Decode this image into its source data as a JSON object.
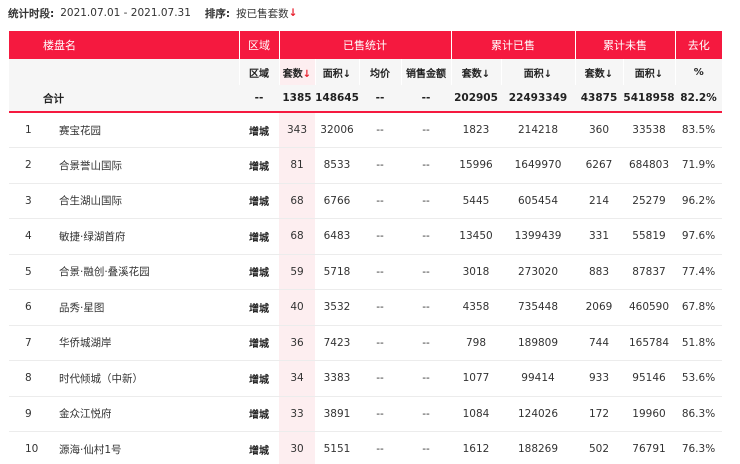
{
  "filter": {
    "period_label": "统计时段:",
    "period_value": "2021.07.01 - 2021.07.31",
    "sort_label": "排序:",
    "sort_value": "按已售套数",
    "sort_arrow": "↓"
  },
  "header": {
    "project": "楼盘名",
    "region": "区域",
    "sold_stats": "已售统计",
    "cum_sold": "累计已售",
    "cum_unsold": "累计未售",
    "absorption": "去化"
  },
  "subheader": {
    "region": "区域",
    "units": "套数",
    "units_arrow": "↓",
    "area": "面积↓",
    "avg_price": "均价",
    "sales_amount": "销售金额",
    "cum_units": "套数↓",
    "cum_area": "面积↓",
    "unsold_units": "套数↓",
    "unsold_area": "面积↓",
    "percent": "%"
  },
  "total": {
    "label": "合计",
    "region": "--",
    "units": "1385",
    "area": "148645",
    "avg_price": "--",
    "amount": "--",
    "cum_units": "202905",
    "cum_area": "22493349",
    "unsold_units": "43875",
    "unsold_area": "5418958",
    "rate": "82.2%"
  },
  "rows": [
    {
      "idx": "1",
      "name": "赛宝花园",
      "region": "增城",
      "units": "343",
      "area": "32006",
      "avg": "--",
      "amount": "--",
      "cum_units": "1823",
      "cum_area": "214218",
      "unsold_units": "360",
      "unsold_area": "33538",
      "rate": "83.5%"
    },
    {
      "idx": "2",
      "name": "合景誉山国际",
      "region": "增城",
      "units": "81",
      "area": "8533",
      "avg": "--",
      "amount": "--",
      "cum_units": "15996",
      "cum_area": "1649970",
      "unsold_units": "6267",
      "unsold_area": "684803",
      "rate": "71.9%"
    },
    {
      "idx": "3",
      "name": "合生湖山国际",
      "region": "增城",
      "units": "68",
      "area": "6766",
      "avg": "--",
      "amount": "--",
      "cum_units": "5445",
      "cum_area": "605454",
      "unsold_units": "214",
      "unsold_area": "25279",
      "rate": "96.2%"
    },
    {
      "idx": "4",
      "name": "敏捷·绿湖首府",
      "region": "增城",
      "units": "68",
      "area": "6483",
      "avg": "--",
      "amount": "--",
      "cum_units": "13450",
      "cum_area": "1399439",
      "unsold_units": "331",
      "unsold_area": "55819",
      "rate": "97.6%"
    },
    {
      "idx": "5",
      "name": "合景·融创·叠溪花园",
      "region": "增城",
      "units": "59",
      "area": "5718",
      "avg": "--",
      "amount": "--",
      "cum_units": "3018",
      "cum_area": "273020",
      "unsold_units": "883",
      "unsold_area": "87837",
      "rate": "77.4%"
    },
    {
      "idx": "6",
      "name": "品秀·星图",
      "region": "增城",
      "units": "40",
      "area": "3532",
      "avg": "--",
      "amount": "--",
      "cum_units": "4358",
      "cum_area": "735448",
      "unsold_units": "2069",
      "unsold_area": "460590",
      "rate": "67.8%"
    },
    {
      "idx": "7",
      "name": "华侨城湖岸",
      "region": "增城",
      "units": "36",
      "area": "7423",
      "avg": "--",
      "amount": "--",
      "cum_units": "798",
      "cum_area": "189809",
      "unsold_units": "744",
      "unsold_area": "165784",
      "rate": "51.8%"
    },
    {
      "idx": "8",
      "name": "时代倾城（中新）",
      "region": "增城",
      "units": "34",
      "area": "3383",
      "avg": "--",
      "amount": "--",
      "cum_units": "1077",
      "cum_area": "99414",
      "unsold_units": "933",
      "unsold_area": "95146",
      "rate": "53.6%"
    },
    {
      "idx": "9",
      "name": "金众江悦府",
      "region": "增城",
      "units": "33",
      "area": "3891",
      "avg": "--",
      "amount": "--",
      "cum_units": "1084",
      "cum_area": "124026",
      "unsold_units": "172",
      "unsold_area": "19960",
      "rate": "86.3%"
    },
    {
      "idx": "10",
      "name": "源海·仙村1号",
      "region": "增城",
      "units": "30",
      "area": "5151",
      "avg": "--",
      "amount": "--",
      "cum_units": "1612",
      "cum_area": "188269",
      "unsold_units": "502",
      "unsold_area": "76791",
      "rate": "76.3%"
    }
  ],
  "colors": {
    "accent": "#f5193f",
    "highlight_col": "#fdeef0",
    "header_bg": "#f6f6f6"
  }
}
